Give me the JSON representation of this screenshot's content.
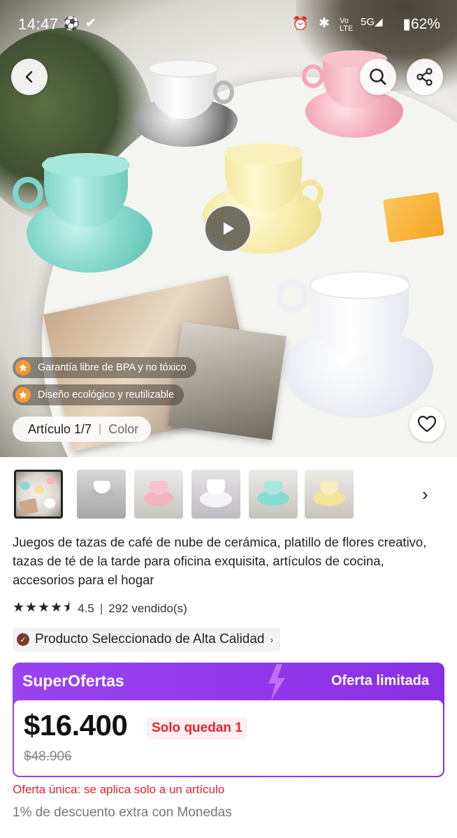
{
  "status_bar": {
    "time": "14:47",
    "battery": "62%"
  },
  "hero": {
    "badges": [
      {
        "label": "Garantía libre de BPA y no tóxico"
      },
      {
        "label": "Diseño ecológico y reutilizable"
      }
    ],
    "article_counter": "Artículo 1/7",
    "color_label": "Color"
  },
  "product": {
    "title": "Juegos de tazas de café de nube de cerámica, platillo de flores creativo, tazas de té de la tarde para oficina exquisita, artículos de cocina, accesorios para el hogar",
    "rating": "4.5",
    "sold": "292 vendido(s)",
    "quality_badge": "Producto Seleccionado de Alta Calidad"
  },
  "deal": {
    "brand": "SuperOfertas",
    "limited": "Oferta limitada",
    "price": "$16.400",
    "stock": "Solo quedan 1",
    "old_price": "$48.906",
    "once_note": "Oferta única: se aplica solo a un artículo",
    "coins_note": "1% de descuento extra con Monedas"
  },
  "colors": {
    "accent": "#8a2fe6",
    "sale_red": "#e0232f",
    "badge_orange": "#f59a2a"
  },
  "thumbnail_colors": [
    "#dcd7cf",
    "#c9c9cb",
    "#f2b3c3",
    "#e9e9ee",
    "#89dcd2",
    "#f3e49a"
  ]
}
